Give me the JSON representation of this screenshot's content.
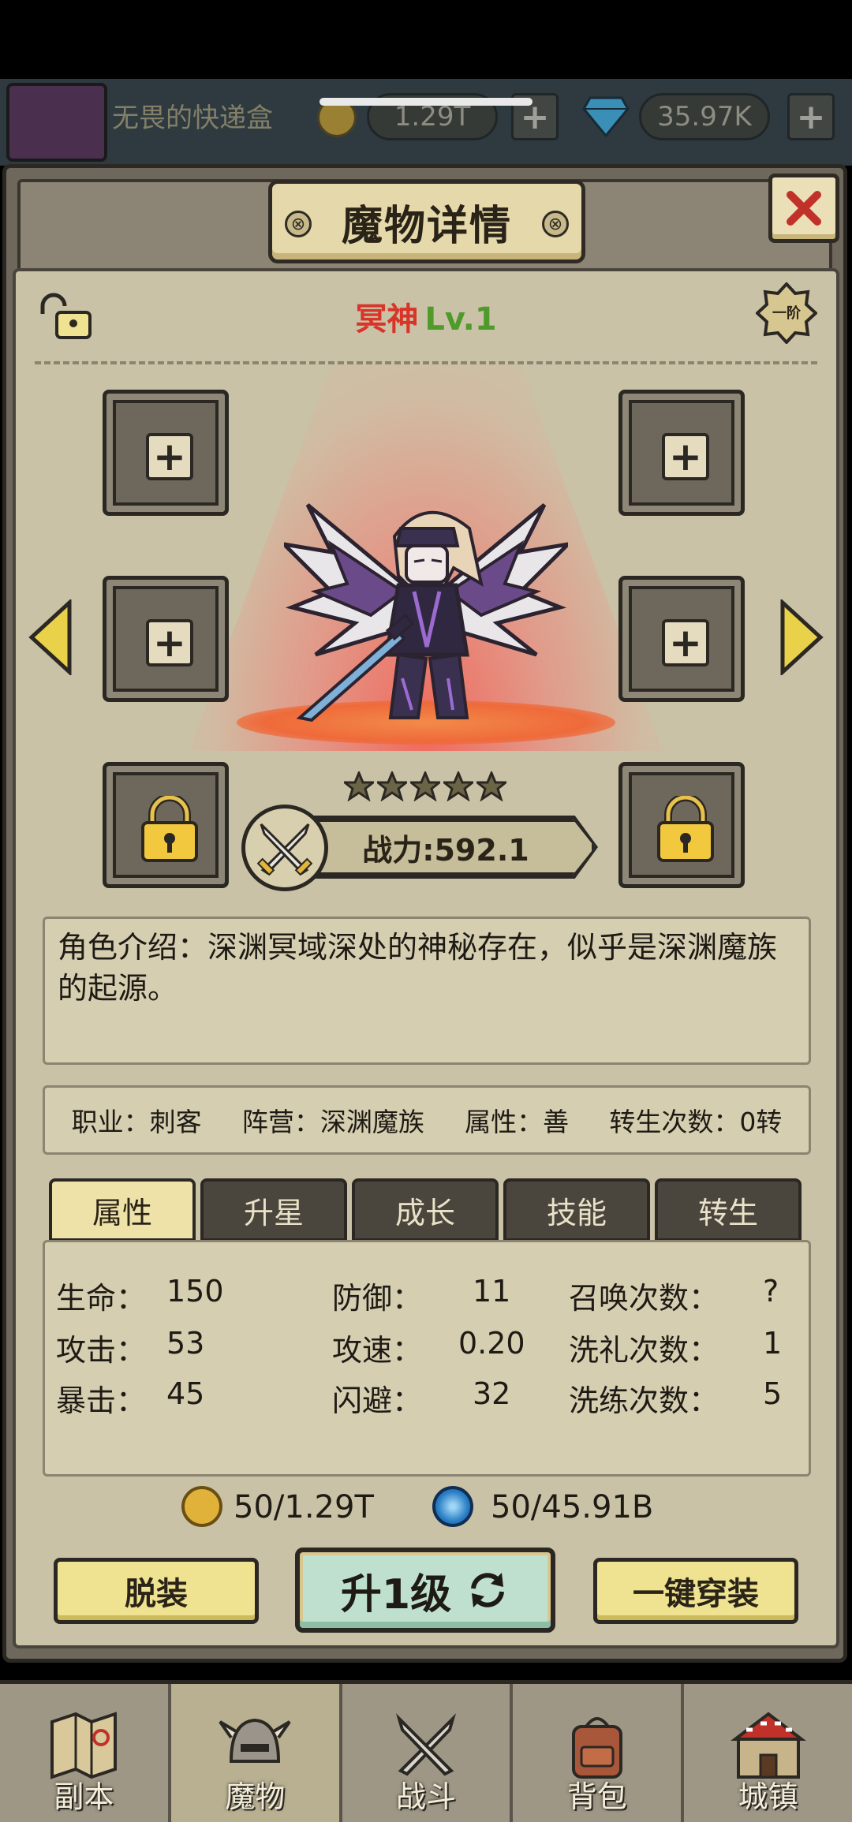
{
  "top_bar": {
    "player_name": "无畏的快递盒",
    "gold": "1.29T",
    "gems": "35.97K",
    "add_symbol": "+"
  },
  "modal": {
    "title": "魔物详情",
    "close_symbol": "×"
  },
  "monster": {
    "name": "冥神",
    "level": "Lv.1",
    "tier": "一阶",
    "stars": 5,
    "power": "战力:592.1",
    "intro": "角色介绍：深渊冥域深处的神秘存在，似乎是深渊魔族的起源。"
  },
  "info": {
    "profession": "职业：刺客",
    "faction": "阵营：深渊魔族",
    "attribute": "属性：善",
    "rebirth": "转生次数：0转"
  },
  "tabs": [
    {
      "label": "属性",
      "active": true
    },
    {
      "label": "升星",
      "active": false
    },
    {
      "label": "成长",
      "active": false
    },
    {
      "label": "技能",
      "active": false
    },
    {
      "label": "转生",
      "active": false
    }
  ],
  "stats": {
    "hp_label": "生命：",
    "hp": "150",
    "atk_label": "攻击：",
    "atk": "53",
    "crit_label": "暴击：",
    "crit": "45",
    "def_label": "防御：",
    "def": "11",
    "spd_label": "攻速：",
    "spd": "0.20",
    "dodge_label": "闪避：",
    "dodge": "32",
    "summon_label": "召唤次数：",
    "summon": "?",
    "baptism_label": "洗礼次数：",
    "baptism": "1",
    "refine_label": "洗练次数：",
    "refine": "5"
  },
  "costs": {
    "gold": "50/1.29T",
    "essence": "50/45.91B"
  },
  "buttons": {
    "unequip": "脱装",
    "upgrade": "升1级",
    "equip_all": "一键穿装"
  },
  "bottom_nav": [
    {
      "label": "副本",
      "icon": "map-icon"
    },
    {
      "label": "魔物",
      "icon": "monster-helmet-icon"
    },
    {
      "label": "战斗",
      "icon": "crossed-swords-icon"
    },
    {
      "label": "背包",
      "icon": "backpack-icon"
    },
    {
      "label": "城镇",
      "icon": "town-icon"
    }
  ],
  "colors": {
    "accent_gold": "#efe290",
    "name_red": "#d8352a",
    "level_green": "#4f9a2a",
    "panel_bg": "#c9c2a6"
  }
}
